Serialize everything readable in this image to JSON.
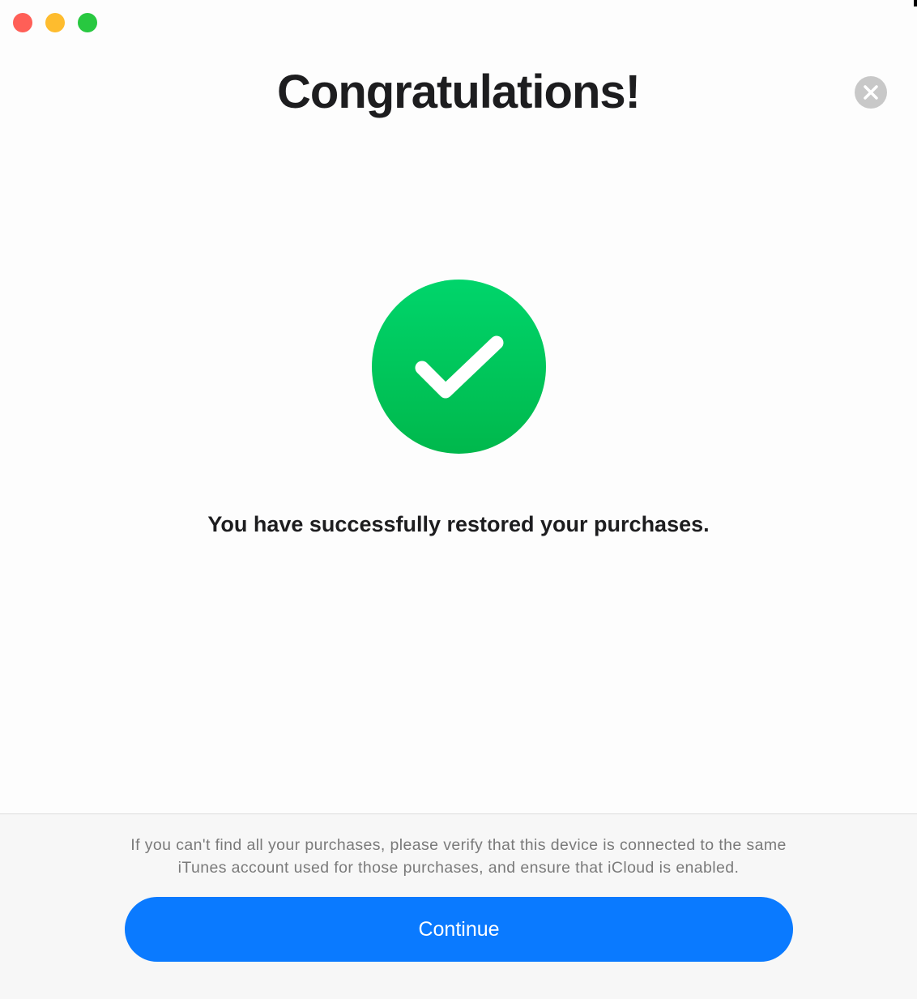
{
  "window": {
    "controls": {
      "close_color": "#ff5f57",
      "minimize_color": "#febc2e",
      "zoom_color": "#28c840"
    }
  },
  "dialog": {
    "title": "Congratulations!",
    "close_icon": "x-circle-icon",
    "status_icon": "checkmark-circle-icon",
    "accent_success": "#00c85a",
    "message": "You have successfully restored your purchases.",
    "note": "If you can't find all your purchases, please verify that this device is connected to the same iTunes account used for those purchases, and ensure that iCloud is enabled.",
    "continue_label": "Continue",
    "accent_button": "#0a7aff"
  }
}
